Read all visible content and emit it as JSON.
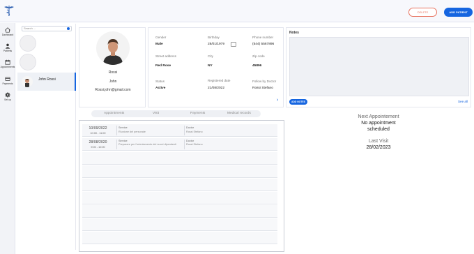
{
  "header": {
    "logo": "medical-caduceus-logo",
    "delete_label": "DELETE",
    "add_patient_label": "ADD PATIENT"
  },
  "nav": [
    {
      "label": "Dashboard",
      "icon": "home-icon"
    },
    {
      "label": "Patients",
      "icon": "person-icon"
    },
    {
      "label": "Appointments",
      "icon": "calendar-icon"
    },
    {
      "label": "Payments",
      "icon": "card-icon"
    },
    {
      "label": "Set up",
      "icon": "gear-icon"
    }
  ],
  "patient_list": {
    "search_placeholder": "Search ...",
    "selected_name": "John Rossi"
  },
  "patient_card": {
    "surname": "Rossi",
    "name": "John",
    "email": "Rossi.john@gmail.com"
  },
  "info": {
    "gender_label": "Gender",
    "gender": "Male",
    "birthday_label": "Birthday",
    "birthday": "28/01/1979",
    "phone_label": "Phone number",
    "phone": "(544) 5567896",
    "street_label": "Street address",
    "street": "Red Rose",
    "city_label": "City",
    "city": "NY",
    "zip_label": "Zip code",
    "zip": "45896",
    "status_label": "Status",
    "status": "Active",
    "registered_label": "Registered date",
    "registered": "21/08/2022",
    "follow_label": "Follow by Doctor",
    "follow": "Rossi Stefano"
  },
  "notes": {
    "title": "Notes",
    "add_label": "ADD NOTES",
    "see_all": "See all"
  },
  "tabs": [
    "Appointments",
    "Visit",
    "Payments",
    "Medical records"
  ],
  "appointments": [
    {
      "date": "10/09/2022",
      "time": "10:00 - 11:00",
      "service_label": "Service",
      "service": "Riunione del personale",
      "doctor_label": "Doctor",
      "doctor": "Rossi Stefano"
    },
    {
      "date": "28/08/2020",
      "time": "9:00 - 10:00",
      "service_label": "Service",
      "service": "Preparare per l'orientamento dei nuovi dipendenti",
      "doctor_label": "Doctor",
      "doctor": "Rossi Stefano"
    }
  ],
  "next": {
    "next_title": "Next Appointement",
    "next_value_1": "No appointment",
    "next_value_2": "scheduled",
    "last_title": "Last Visit",
    "last_value": "28/02/2023"
  }
}
